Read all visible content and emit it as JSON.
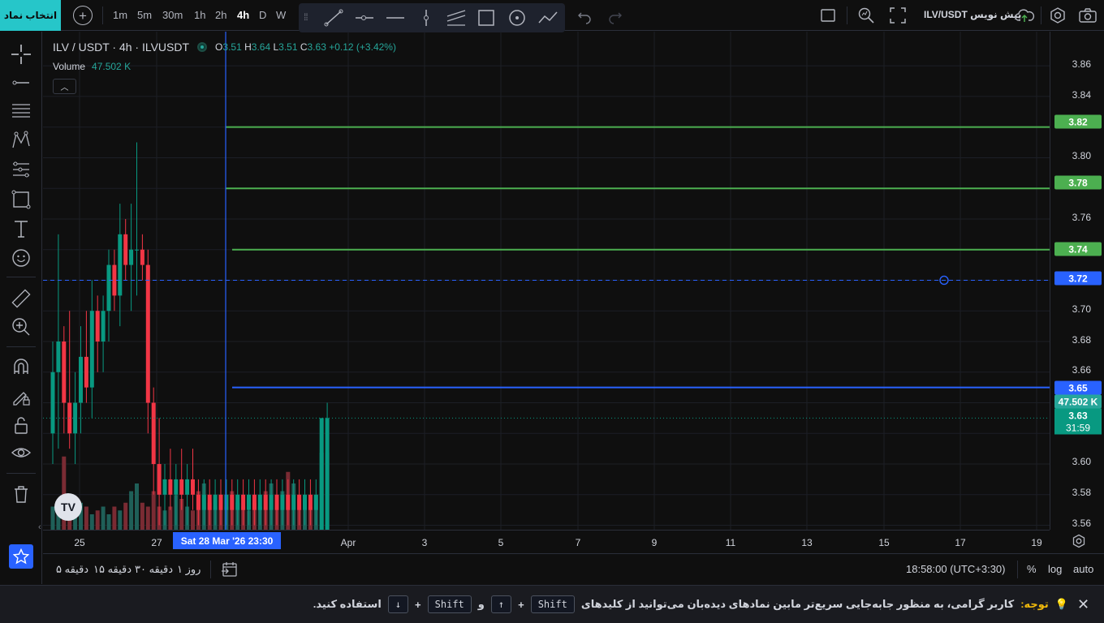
{
  "topbar": {
    "symbol_button": "انتخاب نماد",
    "intervals": [
      "1m",
      "5m",
      "30m",
      "1h",
      "2h",
      "4h",
      "D",
      "W"
    ],
    "active_interval": "4h",
    "pre_note": "ILV/USDT پیش نویس"
  },
  "legend": {
    "title": "ILV / USDT · 4h · ILVUSDT",
    "open_label": "O",
    "open": "3.51",
    "high_label": "H",
    "high": "3.64",
    "low_label": "L",
    "low": "3.51",
    "close_label": "C",
    "close": "3.63",
    "change": "+0.12 (+3.42%)",
    "volume_label": "Volume",
    "volume_value": "47.502 K"
  },
  "price_axis": {
    "labels": [
      "3.86",
      "3.84",
      "3.80",
      "3.76",
      "3.70",
      "3.68",
      "3.66",
      "3.60",
      "3.58",
      "3.56"
    ],
    "tags": [
      {
        "text": "3.82",
        "color": "#4caf50"
      },
      {
        "text": "3.78",
        "color": "#4caf50"
      },
      {
        "text": "3.74",
        "color": "#4caf50"
      },
      {
        "text": "3.72",
        "color": "#2962ff"
      },
      {
        "text": "3.65",
        "color": "#2962ff"
      },
      {
        "text": "47.502 K",
        "color": "#26a69a"
      },
      {
        "text": "3.63",
        "color": "#089981"
      },
      {
        "text": "31:59",
        "color": "#089981"
      }
    ]
  },
  "time_axis": {
    "labels": [
      "25",
      "27",
      "Apr",
      "3",
      "5",
      "7",
      "9",
      "11",
      "13",
      "15",
      "17",
      "19"
    ],
    "cursor_label": "Sat 28 Mar '26   23:30"
  },
  "bottombar": {
    "ranges": [
      "۵ دقیقه",
      "۱۵ دقیقه",
      "۳۰ دقیقه",
      "۱ روز"
    ],
    "timezone": "18:58:00 (UTC+3:30)",
    "percent": "%",
    "log": "log",
    "auto": "auto"
  },
  "notice": {
    "label": "توجه:",
    "text1": "کاربر گرامی، به منظور جابه‌جایی سریع‌تر مابین نمادهای دیده‌بان می‌توانید از کلیدهای",
    "key_shift": "Shift",
    "plus": "+",
    "key_up": "↑",
    "and": "و",
    "key_down": "↓",
    "text2": "استفاده کنید."
  },
  "chart_data": {
    "type": "candlestick",
    "symbol": "ILV / USDT",
    "interval": "4h",
    "price_ylim": [
      3.555,
      3.875
    ],
    "horizontal_lines": [
      {
        "price": 3.82,
        "color": "#4caf50"
      },
      {
        "price": 3.78,
        "color": "#4caf50"
      },
      {
        "price": 3.74,
        "color": "#4caf50"
      },
      {
        "price": 3.72,
        "color": "#2962ff",
        "style": "dashed"
      },
      {
        "price": 3.65,
        "color": "#2962ff"
      }
    ],
    "last_price": 3.63,
    "last_volume": "47.502 K",
    "candles": [
      [
        3.62,
        3.68,
        3.6,
        3.66
      ],
      [
        3.66,
        3.75,
        3.61,
        3.68
      ],
      [
        3.68,
        3.69,
        3.62,
        3.64
      ],
      [
        3.64,
        3.7,
        3.61,
        3.62
      ],
      [
        3.62,
        3.66,
        3.6,
        3.64
      ],
      [
        3.64,
        3.69,
        3.62,
        3.67
      ],
      [
        3.67,
        3.7,
        3.64,
        3.65
      ],
      [
        3.65,
        3.72,
        3.63,
        3.7
      ],
      [
        3.7,
        3.71,
        3.66,
        3.68
      ],
      [
        3.68,
        3.71,
        3.66,
        3.7
      ],
      [
        3.7,
        3.74,
        3.68,
        3.73
      ],
      [
        3.73,
        3.74,
        3.7,
        3.71
      ],
      [
        3.71,
        3.77,
        3.69,
        3.75
      ],
      [
        3.75,
        3.76,
        3.72,
        3.73
      ],
      [
        3.73,
        3.77,
        3.7,
        3.74
      ],
      [
        3.74,
        3.81,
        3.71,
        3.74
      ],
      [
        3.74,
        3.75,
        3.72,
        3.73
      ],
      [
        3.73,
        3.74,
        3.62,
        3.64
      ],
      [
        3.64,
        3.65,
        3.58,
        3.6
      ],
      [
        3.6,
        3.63,
        3.56,
        3.58
      ],
      [
        3.58,
        3.6,
        3.56,
        3.59
      ],
      [
        3.59,
        3.61,
        3.57,
        3.58
      ],
      [
        3.58,
        3.6,
        3.56,
        3.59
      ],
      [
        3.59,
        3.61,
        3.57,
        3.58
      ],
      [
        3.58,
        3.6,
        3.56,
        3.59
      ],
      [
        3.59,
        3.61,
        3.57,
        3.58
      ],
      [
        3.58,
        3.59,
        3.56,
        3.57
      ],
      [
        3.57,
        3.59,
        3.56,
        3.58
      ],
      [
        3.58,
        3.59,
        3.56,
        3.57
      ],
      [
        3.57,
        3.59,
        3.56,
        3.58
      ],
      [
        3.58,
        3.59,
        3.56,
        3.57
      ],
      [
        3.57,
        3.59,
        3.56,
        3.58
      ],
      [
        3.58,
        3.59,
        3.56,
        3.57
      ],
      [
        3.57,
        3.59,
        3.56,
        3.58
      ],
      [
        3.58,
        3.59,
        3.56,
        3.57
      ],
      [
        3.57,
        3.59,
        3.56,
        3.58
      ],
      [
        3.58,
        3.59,
        3.56,
        3.57
      ],
      [
        3.57,
        3.59,
        3.56,
        3.58
      ],
      [
        3.58,
        3.59,
        3.56,
        3.57
      ],
      [
        3.57,
        3.59,
        3.56,
        3.58
      ],
      [
        3.58,
        3.59,
        3.56,
        3.57
      ],
      [
        3.57,
        3.59,
        3.56,
        3.58
      ],
      [
        3.58,
        3.59,
        3.56,
        3.57
      ],
      [
        3.57,
        3.59,
        3.56,
        3.58
      ],
      [
        3.58,
        3.59,
        3.56,
        3.57
      ],
      [
        3.57,
        3.59,
        3.56,
        3.58
      ],
      [
        3.58,
        3.59,
        3.56,
        3.57
      ],
      [
        3.57,
        3.59,
        3.56,
        3.58
      ],
      [
        3.51,
        3.63,
        3.51,
        3.63
      ],
      [
        3.51,
        3.64,
        3.51,
        3.63
      ]
    ],
    "volumes": [
      0.3,
      0.25,
      0.95,
      0.4,
      0.3,
      0.35,
      0.3,
      0.2,
      0.25,
      0.3,
      0.2,
      0.3,
      0.25,
      0.35,
      0.5,
      0.6,
      0.35,
      0.3,
      0.5,
      0.3,
      0.25,
      0.3,
      0.45,
      0.4,
      0.3,
      0.25,
      0.5,
      0.6,
      0.35,
      0.3,
      0.4,
      0.3,
      0.5,
      0.35,
      0.3,
      0.25,
      0.35,
      0.3,
      0.5,
      0.6,
      0.35,
      0.5,
      0.75,
      0.6,
      0.4,
      0.35,
      0.3,
      0.45,
      1.0,
      1.0
    ]
  }
}
